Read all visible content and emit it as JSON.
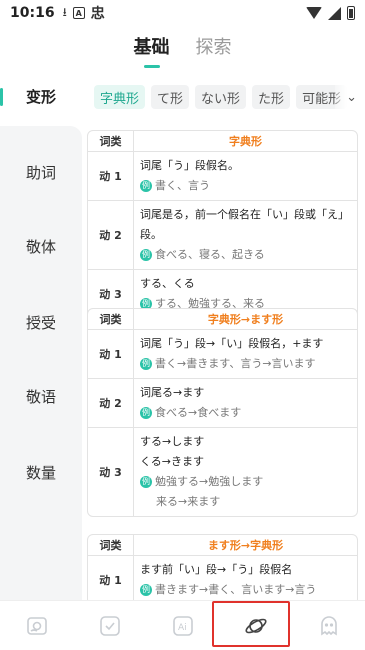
{
  "status_bar": {
    "time": "10:16",
    "icons": [
      "download-icon",
      "a-box-icon",
      "app-logo-icon",
      "wifi-icon",
      "signal-icon",
      "battery-icon"
    ],
    "box_letter": "A",
    "logo_glyph": "忠"
  },
  "top_tabs": [
    {
      "label": "基础",
      "active": true
    },
    {
      "label": "探索",
      "active": false
    }
  ],
  "sidebar": {
    "items": [
      {
        "label": "变形",
        "active": true
      },
      {
        "label": "助词",
        "active": false
      },
      {
        "label": "敬体",
        "active": false
      },
      {
        "label": "授受",
        "active": false
      },
      {
        "label": "敬语",
        "active": false
      },
      {
        "label": "数量",
        "active": false
      }
    ]
  },
  "chips": {
    "items": [
      {
        "label": "字典形",
        "active": true
      },
      {
        "label": "て形",
        "active": false
      },
      {
        "label": "ない形",
        "active": false
      },
      {
        "label": "た形",
        "active": false
      },
      {
        "label": "可能形",
        "active": false
      }
    ],
    "more_icon": "chevron-down-icon",
    "more_glyph": "⌄"
  },
  "tables": [
    {
      "header_label": "词类",
      "header_title": "字典形",
      "rows": [
        {
          "label": "动 1",
          "lines": [
            {
              "type": "text",
              "text": "词尾「う」段假名。"
            },
            {
              "type": "example",
              "text": "書く、言う"
            }
          ]
        },
        {
          "label": "动 2",
          "lines": [
            {
              "type": "text",
              "text": "词尾是る，前一个假名在「い」段或「え」段。"
            },
            {
              "type": "example",
              "text": "食べる、寝る、起きる"
            }
          ]
        },
        {
          "label": "动 3",
          "lines": [
            {
              "type": "text",
              "text": "する、くる"
            },
            {
              "type": "example",
              "text": "する、勉強する、来る"
            }
          ]
        }
      ]
    },
    {
      "header_label": "词类",
      "header_title": "字典形→ます形",
      "rows": [
        {
          "label": "动 1",
          "lines": [
            {
              "type": "text",
              "text": "词尾「う」段→「い」段假名，+ます"
            },
            {
              "type": "example",
              "text": "書く→書きます、言う→言います"
            }
          ]
        },
        {
          "label": "动 2",
          "lines": [
            {
              "type": "text",
              "text": "词尾る→ます"
            },
            {
              "type": "example",
              "text": "食べる→食べます"
            }
          ]
        },
        {
          "label": "动 3",
          "lines": [
            {
              "type": "text",
              "text": "する→します"
            },
            {
              "type": "text",
              "text": "くる→きます"
            },
            {
              "type": "example",
              "text": "勉強する→勉強します"
            },
            {
              "type": "indent",
              "text": "来る→来ます"
            }
          ]
        }
      ]
    },
    {
      "header_label": "词类",
      "header_title": "ます形→字典形",
      "rows": [
        {
          "label": "动 1",
          "lines": [
            {
              "type": "text",
              "text": "ます前「い」段→「う」段假名"
            },
            {
              "type": "example",
              "text": "書きます→書く、言います→言う"
            }
          ]
        }
      ]
    }
  ],
  "example_badge": "例",
  "bottom_nav": [
    {
      "name": "picture-book-icon",
      "label": ""
    },
    {
      "name": "notebook-check-icon",
      "label": ""
    },
    {
      "name": "ai-icon",
      "label": "Ai"
    },
    {
      "name": "planet-icon",
      "label": ""
    },
    {
      "name": "ghost-icon",
      "label": ""
    }
  ],
  "colors": {
    "accent": "#2bc3a8",
    "header_orange": "#f07f1e",
    "highlight_red": "#e0322c"
  }
}
